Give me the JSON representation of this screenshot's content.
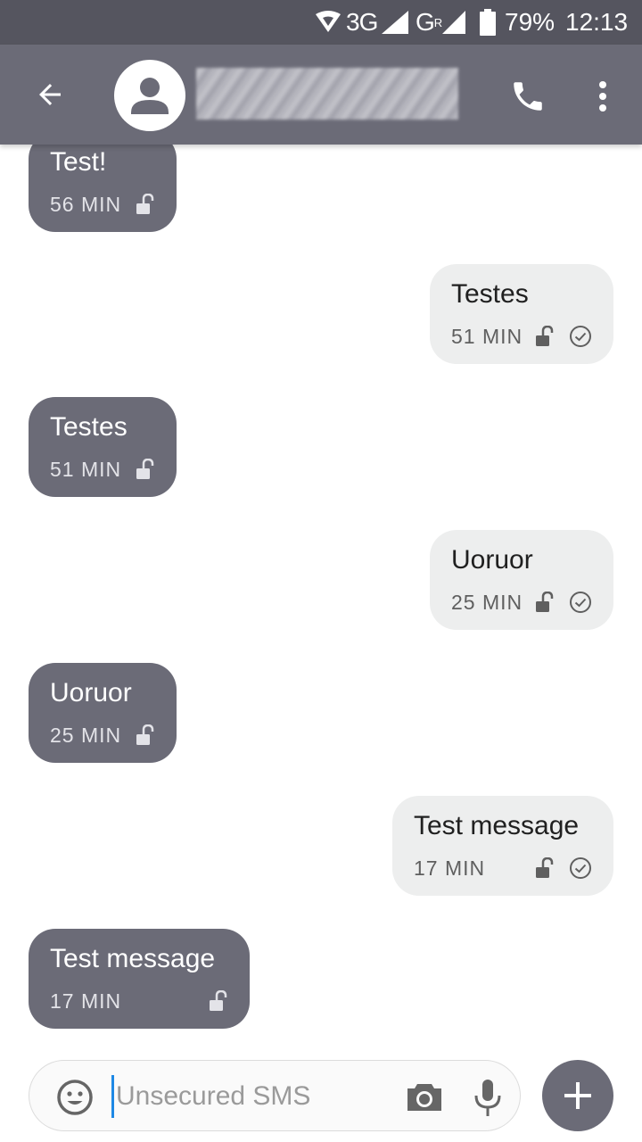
{
  "status_bar": {
    "network_1": "3G",
    "network_2": "G",
    "network_2_roaming": "R",
    "battery": "79%",
    "time": "12:13",
    "icons": [
      "wifi-icon",
      "signal-icon",
      "battery-icon"
    ]
  },
  "app_bar": {
    "icons": [
      "back-arrow-icon",
      "contact-avatar-icon",
      "phone-icon",
      "more-vert-icon"
    ]
  },
  "messages": [
    {
      "direction": "incoming",
      "text": "Test!",
      "time": "56 MIN",
      "icons": [
        "unlocked-icon"
      ]
    },
    {
      "direction": "outgoing",
      "text": "Testes",
      "time": "51 MIN",
      "icons": [
        "unlocked-icon",
        "delivered-check-icon"
      ]
    },
    {
      "direction": "incoming",
      "text": "Testes",
      "time": "51 MIN",
      "icons": [
        "unlocked-icon"
      ]
    },
    {
      "direction": "outgoing",
      "text": "Uoruor",
      "time": "25 MIN",
      "icons": [
        "unlocked-icon",
        "delivered-check-icon"
      ]
    },
    {
      "direction": "incoming",
      "text": "Uoruor",
      "time": "25 MIN",
      "icons": [
        "unlocked-icon"
      ]
    },
    {
      "direction": "outgoing",
      "text": "Test message",
      "time": "17 MIN",
      "icons": [
        "unlocked-icon",
        "delivered-check-icon"
      ]
    },
    {
      "direction": "incoming",
      "text": "Test message",
      "time": "17 MIN",
      "icons": [
        "unlocked-icon"
      ]
    }
  ],
  "compose": {
    "placeholder": "Unsecured SMS",
    "value": "",
    "icons": [
      "emoji-icon",
      "camera-icon",
      "mic-icon",
      "plus-icon"
    ]
  },
  "colors": {
    "status_bar": "#55555f",
    "app_bar": "#6b6b77",
    "incoming_bubble": "#6b6b77",
    "outgoing_bubble": "#edeeee",
    "cursor": "#1e88e5"
  }
}
